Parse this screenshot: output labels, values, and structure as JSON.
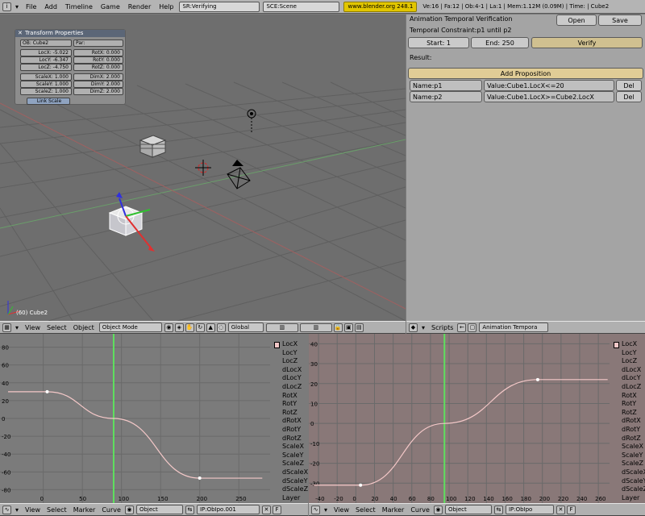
{
  "topbar": {
    "menus": [
      "File",
      "Add",
      "Timeline",
      "Game",
      "Render",
      "Help"
    ],
    "screen": "SR:Verifying",
    "scene": "SCE:Scene",
    "url": "www.blender.org 248.1",
    "stats": "Ve:16 | Fa:12 | Ob:4-1 | La:1 | Mem:1.12M (0.09M) | Time: | Cube2"
  },
  "transform": {
    "title": "Transform Properties",
    "ob": "OB: Cube2",
    "par": "Par:",
    "loc_x": "LocX: -5.022",
    "loc_y": "LocY: -6.347",
    "loc_z": "LocZ: -4.750",
    "rot_x": "RotX: 0.000",
    "rot_y": "RotY: 0.000",
    "rot_z": "RotZ: 0.000",
    "scale_x": "ScaleX: 1.000",
    "scale_y": "ScaleY: 1.000",
    "scale_z": "ScaleZ: 1.000",
    "dim_x": "DimX: 2.000",
    "dim_y": "DimY: 2.000",
    "dim_z": "DimZ: 2.000",
    "link_scale": "Link Scale"
  },
  "viewport": {
    "status": "(60) Cube2",
    "header": {
      "menus": [
        "View",
        "Select",
        "Object"
      ],
      "mode": "Object Mode",
      "orientation": "Global"
    }
  },
  "script": {
    "title": "Animation Temporal Verification",
    "open": "Open",
    "save": "Save",
    "constraint": "Temporal Constraint:p1 until p2",
    "start": "Start: 1",
    "end": "End: 250",
    "verify": "Verify",
    "result": "Result:",
    "add_prop": "Add Proposition",
    "props": [
      {
        "name": "Name:p1",
        "value": "Value:Cube1.LocX<=20",
        "del": "Del"
      },
      {
        "name": "Name:p2",
        "value": "Value:Cube1.LocX>=Cube2.LocX",
        "del": "Del"
      }
    ],
    "header": {
      "menu": "Scripts",
      "name": "Animation Tempora"
    }
  },
  "ipo_left": {
    "y_labels": [
      "80",
      "60",
      "40",
      "20",
      "0",
      "-20",
      "-40",
      "-60",
      "-80"
    ],
    "x_labels": [
      "0",
      "50",
      "100",
      "150",
      "200",
      "250"
    ],
    "channels": [
      "LocX",
      "LocY",
      "LocZ",
      "dLocX",
      "dLocY",
      "dLocZ",
      "RotX",
      "RotY",
      "RotZ",
      "dRotX",
      "dRotY",
      "dRotZ",
      "ScaleX",
      "ScaleY",
      "ScaleZ",
      "dScaleX",
      "dScaleY",
      "dScaleZ",
      "Layer"
    ],
    "header": {
      "menus": [
        "View",
        "Select",
        "Marker",
        "Curve"
      ],
      "type": "Object",
      "ipo": "IP:ObIpo.001"
    }
  },
  "ipo_right": {
    "y_labels": [
      "40",
      "30",
      "20",
      "10",
      "0",
      "-10",
      "-20",
      "-30"
    ],
    "x_labels": [
      "-40",
      "-20",
      "0",
      "20",
      "40",
      "60",
      "80",
      "100",
      "120",
      "140",
      "160",
      "180",
      "200",
      "220",
      "240",
      "260"
    ],
    "channels": [
      "LocX",
      "LocY",
      "LocZ",
      "dLocX",
      "dLocY",
      "dLocZ",
      "RotX",
      "RotY",
      "RotZ",
      "dRotX",
      "dRotY",
      "dRotZ",
      "ScaleX",
      "ScaleY",
      "ScaleZ",
      "dScaleX",
      "dScaleY",
      "dScaleZ",
      "Layer"
    ],
    "header": {
      "menus": [
        "View",
        "Select",
        "Marker",
        "Curve"
      ],
      "type": "Object",
      "ipo": "IP:ObIpo"
    }
  },
  "colors": {
    "curve": "#f4c8c8",
    "current_frame": "#5ee05e",
    "panel": "#a4a4a4"
  },
  "chart_data": [
    {
      "type": "line",
      "series": [
        {
          "name": "LocX",
          "values": [
            [
              -45,
              30
            ],
            [
              5,
              30
            ],
            [
              90,
              0
            ],
            [
              200,
              -67
            ],
            [
              280,
              -67
            ]
          ]
        }
      ],
      "current_frame": [
        90
      ]
    },
    {
      "type": "line",
      "series": [
        {
          "name": "LocX",
          "values": [
            [
              -45,
              -31
            ],
            [
              5,
              -31
            ],
            [
              95,
              0
            ],
            [
              195,
              22
            ],
            [
              270,
              22
            ]
          ]
        }
      ],
      "current_frame": [
        95
      ]
    }
  ]
}
